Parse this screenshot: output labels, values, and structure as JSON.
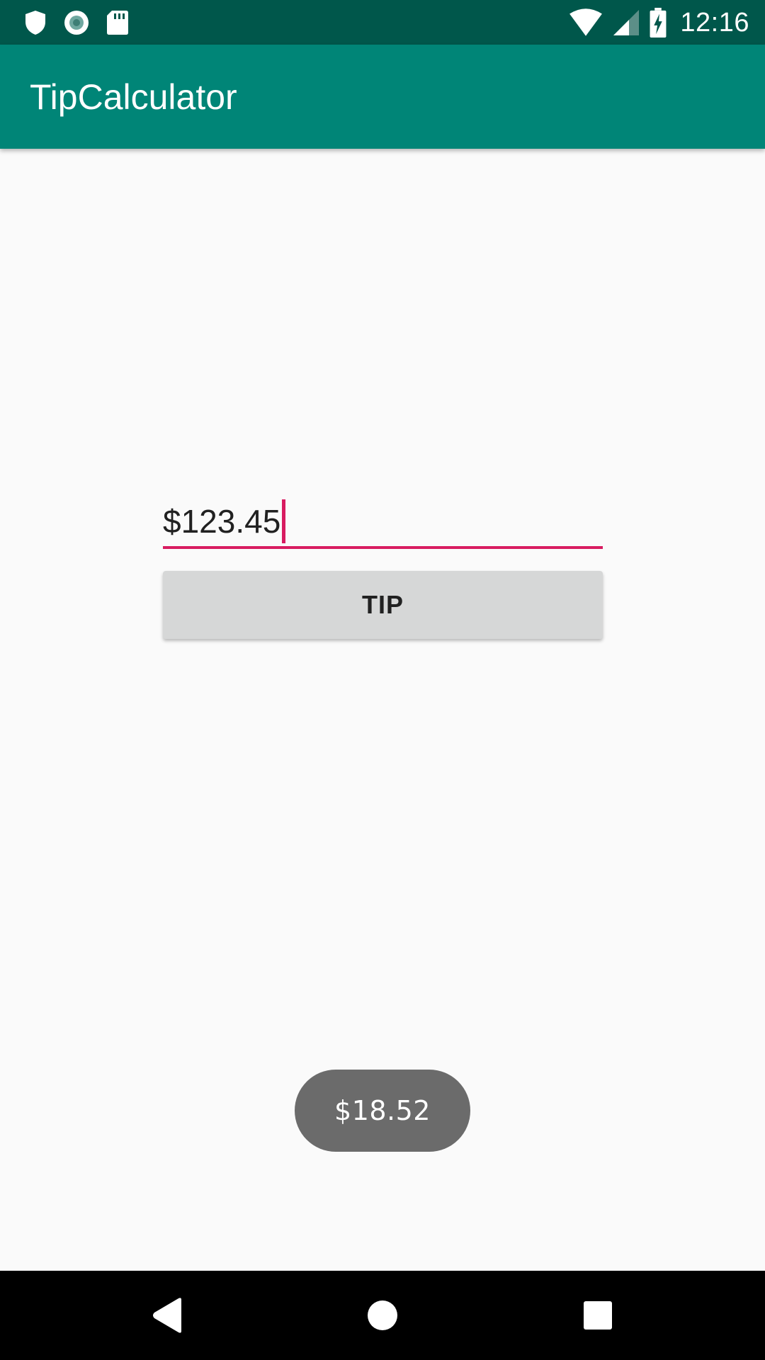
{
  "status_bar": {
    "time": "12:16",
    "left_icons": [
      "shield-icon",
      "circle-notification-icon",
      "sd-card-icon"
    ],
    "right_icons": [
      "wifi-icon",
      "cell-signal-icon",
      "battery-charging-icon"
    ],
    "background": "#00574B"
  },
  "app_bar": {
    "title": "TipCalculator",
    "background": "#008577"
  },
  "form": {
    "amount_value": "$123.45",
    "tip_button_label": "TIP",
    "accent_color": "#D81B60"
  },
  "toast": {
    "message": "$18.52"
  },
  "nav_bar": {
    "buttons": [
      "back-icon",
      "home-icon",
      "recents-icon"
    ]
  }
}
